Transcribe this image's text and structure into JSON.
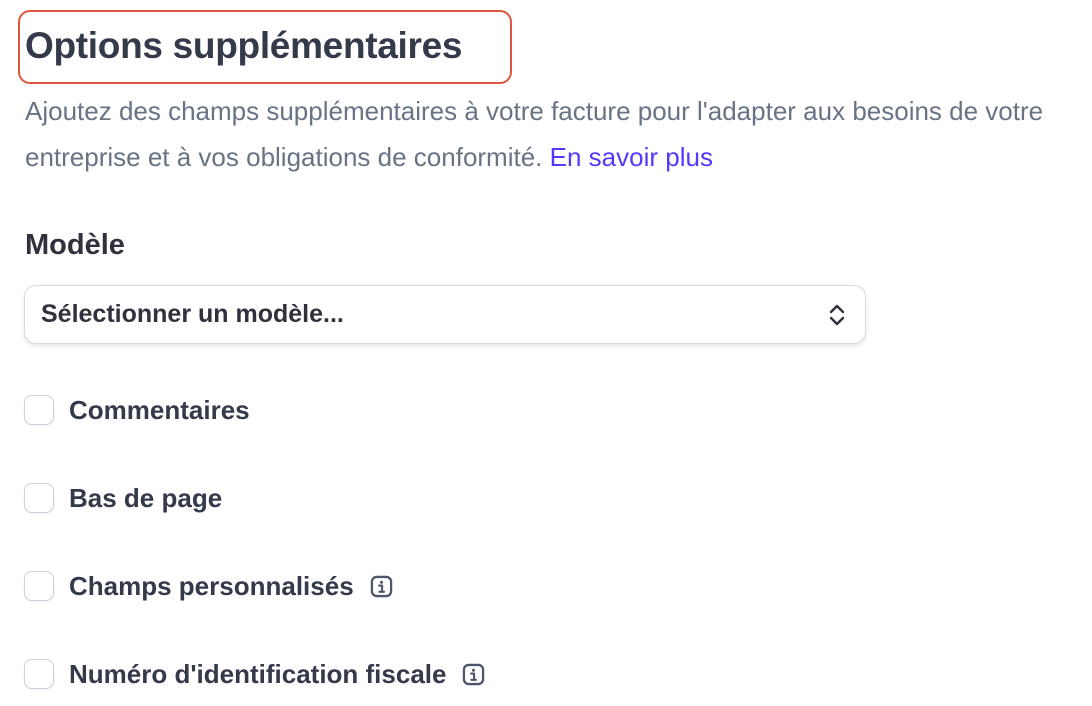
{
  "header": {
    "title": "Options supplémentaires",
    "description": "Ajoutez des champs supplémentaires à votre facture pour l'adapter aux besoins de votre entreprise et à vos obligations de conformité.",
    "learn_more": "En savoir plus"
  },
  "template": {
    "label": "Modèle",
    "select_value": "Sélectionner un modèle..."
  },
  "options": [
    {
      "label": "Commentaires",
      "checked": false
    },
    {
      "label": "Bas de page",
      "checked": false
    },
    {
      "label": "Champs personnalisés",
      "checked": false,
      "icon": "info-icon"
    },
    {
      "label": "Numéro d'identification fiscale",
      "checked": false,
      "icon": "info-icon"
    }
  ],
  "colors": {
    "highlight_border": "#e0533d",
    "link": "#533afd",
    "text": "#30313d",
    "muted": "#687385"
  }
}
